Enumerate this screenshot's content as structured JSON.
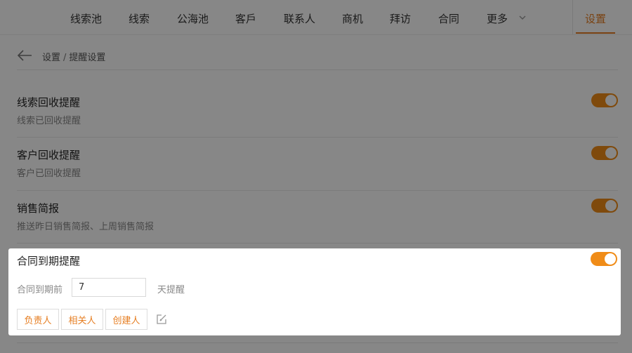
{
  "nav": {
    "items": [
      "线索池",
      "线索",
      "公海池",
      "客戶",
      "联系人",
      "商机",
      "拜访",
      "合同",
      "更多"
    ],
    "settings": "设置"
  },
  "breadcrumb": {
    "parent": "设置",
    "separator": "/",
    "current": "提醒设置"
  },
  "settings": [
    {
      "title": "线索回收提醒",
      "desc": "线索已回收提醒",
      "enabled": true
    },
    {
      "title": "客户回收提醒",
      "desc": "客户已回收提醒",
      "enabled": true
    },
    {
      "title": "销售简报",
      "desc": "推送昨日销售简报、上周销售简报",
      "enabled": true
    }
  ],
  "contract_reminder": {
    "title": "合同到期提醒",
    "enabled": true,
    "prefix_label": "合同到期前",
    "days_value": "7",
    "suffix_label": "天提醒",
    "recipients": [
      "负责人",
      "相关人",
      "创建人"
    ]
  },
  "colors": {
    "accent": "#f08c18",
    "overlay": "rgba(0,0,0,0.47)"
  },
  "icons": {
    "back": "back-arrow-icon",
    "more": "chevron-down-icon",
    "edit": "edit-icon"
  }
}
